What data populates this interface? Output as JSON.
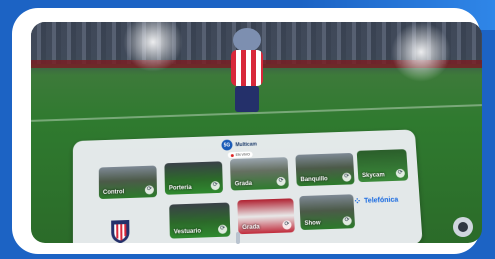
{
  "app": {
    "brand": "Multicam",
    "live_label": "EN VIVO"
  },
  "tiles_top": [
    {
      "label": "Control",
      "style": "t-stadium"
    },
    {
      "label": "Portería",
      "style": "t-goal"
    },
    {
      "label": "Grada",
      "style": "t-bright"
    },
    {
      "label": "Banquillo",
      "style": "t-stadium"
    },
    {
      "label": "Skycam",
      "style": "t-green"
    }
  ],
  "tiles_bottom": [
    {
      "label": "Vestuario",
      "style": "t-goal"
    },
    {
      "label": "Grada",
      "style": "t-red"
    },
    {
      "label": "Show",
      "style": "t-stadium"
    }
  ],
  "sponsor": {
    "name": "Telefónica"
  },
  "colors": {
    "frame": "#ffffff",
    "background": "#1c63c4",
    "telefonica_blue": "#1668e0",
    "club_red": "#d8283a"
  }
}
